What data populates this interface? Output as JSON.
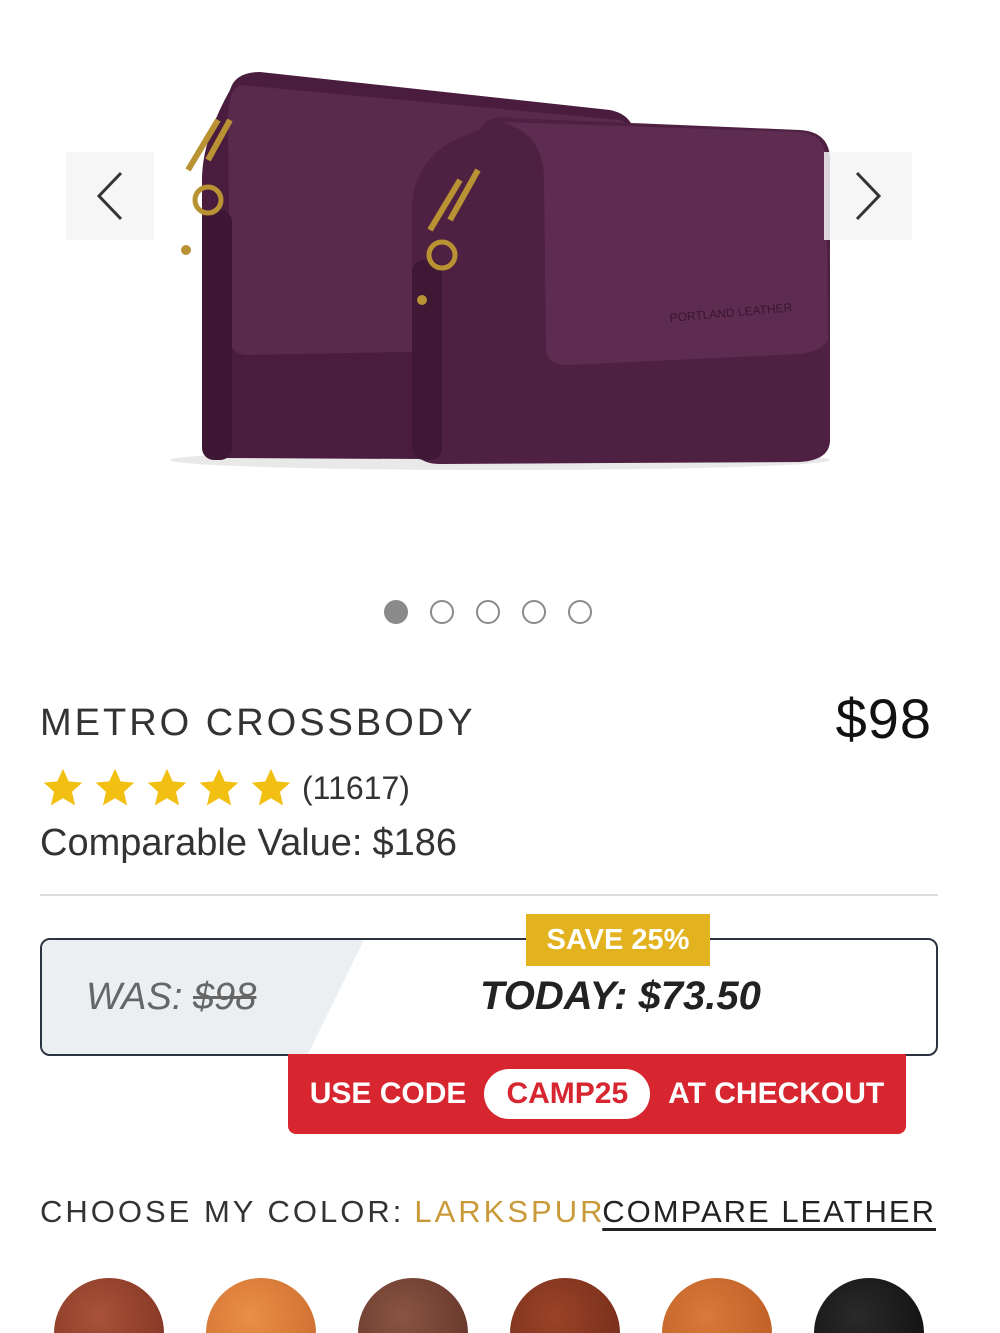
{
  "carousel": {
    "slide_count": 5,
    "active_index": 0,
    "image_alt": "product-photo-two-purple-leather-crossbody-bags",
    "prev_icon": "chevron-left-icon",
    "next_icon": "chevron-right-icon",
    "bag_color": "#4a1c3d",
    "hardware_color": "#b99234"
  },
  "product": {
    "title": "METRO CROSSBODY",
    "price": "$98",
    "rating_stars": 5,
    "rating_count": "(11617)",
    "comparable_label": "Comparable Value:",
    "comparable_price": "$186",
    "star_color": "#f2c012"
  },
  "deal": {
    "was_label": "WAS:",
    "was_price": "$98",
    "today_label": "TODAY: $73.50",
    "save_badge": "SAVE 25%",
    "badge_color": "#e2b21f"
  },
  "promo": {
    "prefix": "USE CODE",
    "code": "CAMP25",
    "suffix": "AT CHECKOUT",
    "banner_color": "#d7262f"
  },
  "colors": {
    "choose_label": "CHOOSE MY COLOR:",
    "selected_color": "LARKSPUR",
    "compare_link": "COMPARE LEATHER",
    "swatches": [
      "#8a3a24",
      "#d77a35",
      "#6e3a2a",
      "#7a2f1c",
      "#c8612a",
      "#151515"
    ]
  }
}
